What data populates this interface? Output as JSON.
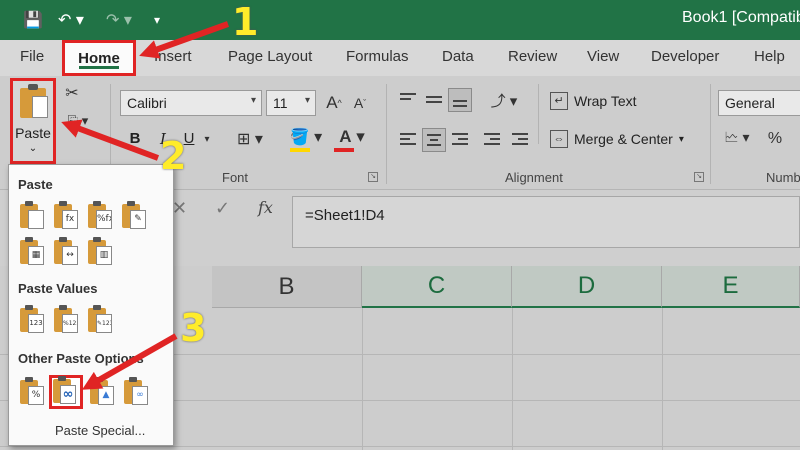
{
  "window": {
    "title": "Book1  [Compatibi"
  },
  "quick_access": {
    "save_icon": "💾",
    "undo_icon": "↶ ▾",
    "redo_icon": "↷ ▾",
    "customize_icon": "▾"
  },
  "tabs": [
    "File",
    "Home",
    "Insert",
    "Page Layout",
    "Formulas",
    "Data",
    "Review",
    "View",
    "Developer",
    "Help"
  ],
  "ribbon": {
    "paste_label": "Paste",
    "paste_chevron": "⌄",
    "cut_icon": "✂",
    "font_name": "Calibri",
    "font_size": "11",
    "grow_font": "A",
    "shrink_font": "A",
    "bold": "B",
    "italic": "I",
    "underline": "U",
    "font_group": "Font",
    "alignment_group": "Alignment",
    "wrap_text": "Wrap Text",
    "merge_center": "Merge & Center",
    "number_format": "General",
    "percent": "%",
    "number_group_partial": "Numb",
    "font_color_hex": "#e02424",
    "fill_color_hex": "#ffd700"
  },
  "formula_bar": {
    "cancel_icon": "✕",
    "enter_icon": "✓",
    "fx": "fx",
    "value": "=Sheet1!D4"
  },
  "grid": {
    "columns": [
      "B",
      "C",
      "D",
      "E"
    ]
  },
  "paste_menu": {
    "sections": [
      "Paste",
      "Paste Values",
      "Other Paste Options"
    ],
    "paste_icons": [
      "",
      "fx",
      "%fx",
      "✎",
      "▦",
      "↔",
      "▥"
    ],
    "values_icons": [
      "123",
      "%123",
      "✎123"
    ],
    "other_icons": [
      "%",
      "∞",
      "▲",
      "∞"
    ],
    "paste_special": "Paste Special..."
  },
  "annotations": {
    "step1": "1",
    "step2": "2",
    "step3": "3",
    "highlight_hex": "#e02424",
    "number_hex": "#ffec2a"
  }
}
